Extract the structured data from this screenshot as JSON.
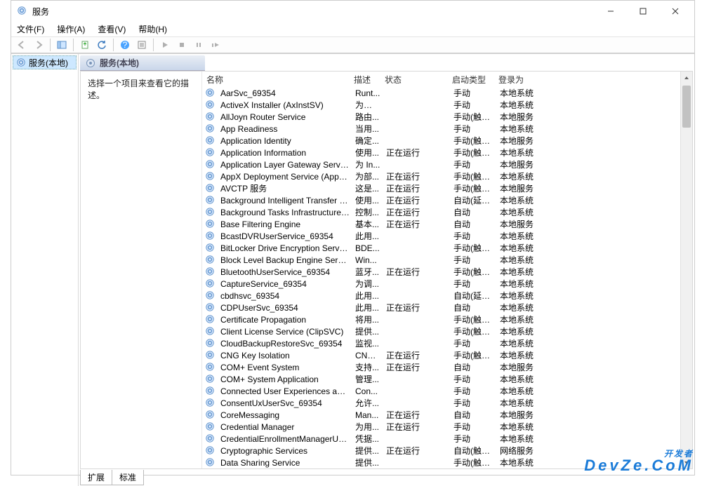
{
  "window": {
    "title": "服务"
  },
  "menubar": {
    "file": "文件(F)",
    "action": "操作(A)",
    "view": "查看(V)",
    "help": "帮助(H)"
  },
  "leftpane": {
    "root": "服务(本地)"
  },
  "rightpane": {
    "header": "服务(本地)",
    "desc_prompt": "选择一个项目来查看它的描述。"
  },
  "columns": {
    "name": "名称",
    "desc": "描述",
    "status": "状态",
    "start": "启动类型",
    "logon": "登录为"
  },
  "tabs": {
    "extended": "扩展",
    "standard": "标准"
  },
  "watermark": {
    "line1": "开发者",
    "line2": "DevZe.CoM"
  },
  "services": [
    {
      "name": "AarSvc_69354",
      "desc": "Runt...",
      "status": "",
      "start": "手动",
      "logon": "本地系统"
    },
    {
      "name": "ActiveX Installer (AxInstSV)",
      "desc": "为从 ...",
      "status": "",
      "start": "手动",
      "logon": "本地系统"
    },
    {
      "name": "AllJoyn Router Service",
      "desc": "路由...",
      "status": "",
      "start": "手动(触发...",
      "logon": "本地服务"
    },
    {
      "name": "App Readiness",
      "desc": "当用...",
      "status": "",
      "start": "手动",
      "logon": "本地系统"
    },
    {
      "name": "Application Identity",
      "desc": "确定...",
      "status": "",
      "start": "手动(触发...",
      "logon": "本地服务"
    },
    {
      "name": "Application Information",
      "desc": "使用...",
      "status": "正在运行",
      "start": "手动(触发...",
      "logon": "本地系统"
    },
    {
      "name": "Application Layer Gateway Service",
      "desc": "为 In...",
      "status": "",
      "start": "手动",
      "logon": "本地服务"
    },
    {
      "name": "AppX Deployment Service (AppXSVC)",
      "desc": "为部...",
      "status": "正在运行",
      "start": "手动(触发...",
      "logon": "本地系统"
    },
    {
      "name": "AVCTP 服务",
      "desc": "这是...",
      "status": "正在运行",
      "start": "手动(触发...",
      "logon": "本地服务"
    },
    {
      "name": "Background Intelligent Transfer Service",
      "desc": "使用...",
      "status": "正在运行",
      "start": "自动(延迟...",
      "logon": "本地系统"
    },
    {
      "name": "Background Tasks Infrastructure Service",
      "desc": "控制...",
      "status": "正在运行",
      "start": "自动",
      "logon": "本地系统"
    },
    {
      "name": "Base Filtering Engine",
      "desc": "基本...",
      "status": "正在运行",
      "start": "自动",
      "logon": "本地服务"
    },
    {
      "name": "BcastDVRUserService_69354",
      "desc": "此用...",
      "status": "",
      "start": "手动",
      "logon": "本地系统"
    },
    {
      "name": "BitLocker Drive Encryption Service",
      "desc": "BDE...",
      "status": "",
      "start": "手动(触发...",
      "logon": "本地系统"
    },
    {
      "name": "Block Level Backup Engine Service",
      "desc": "Win...",
      "status": "",
      "start": "手动",
      "logon": "本地系统"
    },
    {
      "name": "BluetoothUserService_69354",
      "desc": "蓝牙...",
      "status": "正在运行",
      "start": "手动(触发...",
      "logon": "本地系统"
    },
    {
      "name": "CaptureService_69354",
      "desc": "为调...",
      "status": "",
      "start": "手动",
      "logon": "本地系统"
    },
    {
      "name": "cbdhsvc_69354",
      "desc": "此用...",
      "status": "",
      "start": "自动(延迟...",
      "logon": "本地系统"
    },
    {
      "name": "CDPUserSvc_69354",
      "desc": "此用...",
      "status": "正在运行",
      "start": "自动",
      "logon": "本地系统"
    },
    {
      "name": "Certificate Propagation",
      "desc": "将用...",
      "status": "",
      "start": "手动(触发...",
      "logon": "本地系统"
    },
    {
      "name": "Client License Service (ClipSVC)",
      "desc": "提供...",
      "status": "",
      "start": "手动(触发...",
      "logon": "本地系统"
    },
    {
      "name": "CloudBackupRestoreSvc_69354",
      "desc": "监视...",
      "status": "",
      "start": "手动",
      "logon": "本地系统"
    },
    {
      "name": "CNG Key Isolation",
      "desc": "CNG...",
      "status": "正在运行",
      "start": "手动(触发...",
      "logon": "本地系统"
    },
    {
      "name": "COM+ Event System",
      "desc": "支持...",
      "status": "正在运行",
      "start": "自动",
      "logon": "本地服务"
    },
    {
      "name": "COM+ System Application",
      "desc": "管理...",
      "status": "",
      "start": "手动",
      "logon": "本地系统"
    },
    {
      "name": "Connected User Experiences and Telemetry",
      "desc": "Con...",
      "status": "",
      "start": "手动",
      "logon": "本地系统"
    },
    {
      "name": "ConsentUxUserSvc_69354",
      "desc": "允许...",
      "status": "",
      "start": "手动",
      "logon": "本地系统"
    },
    {
      "name": "CoreMessaging",
      "desc": "Man...",
      "status": "正在运行",
      "start": "自动",
      "logon": "本地服务"
    },
    {
      "name": "Credential Manager",
      "desc": "为用...",
      "status": "正在运行",
      "start": "手动",
      "logon": "本地系统"
    },
    {
      "name": "CredentialEnrollmentManagerUserSvc_69...",
      "desc": "凭据...",
      "status": "",
      "start": "手动",
      "logon": "本地系统"
    },
    {
      "name": "Cryptographic Services",
      "desc": "提供...",
      "status": "正在运行",
      "start": "自动(触发...",
      "logon": "网络服务"
    },
    {
      "name": "Data Sharing Service",
      "desc": "提供...",
      "status": "",
      "start": "手动(触发...",
      "logon": "本地系统"
    }
  ]
}
